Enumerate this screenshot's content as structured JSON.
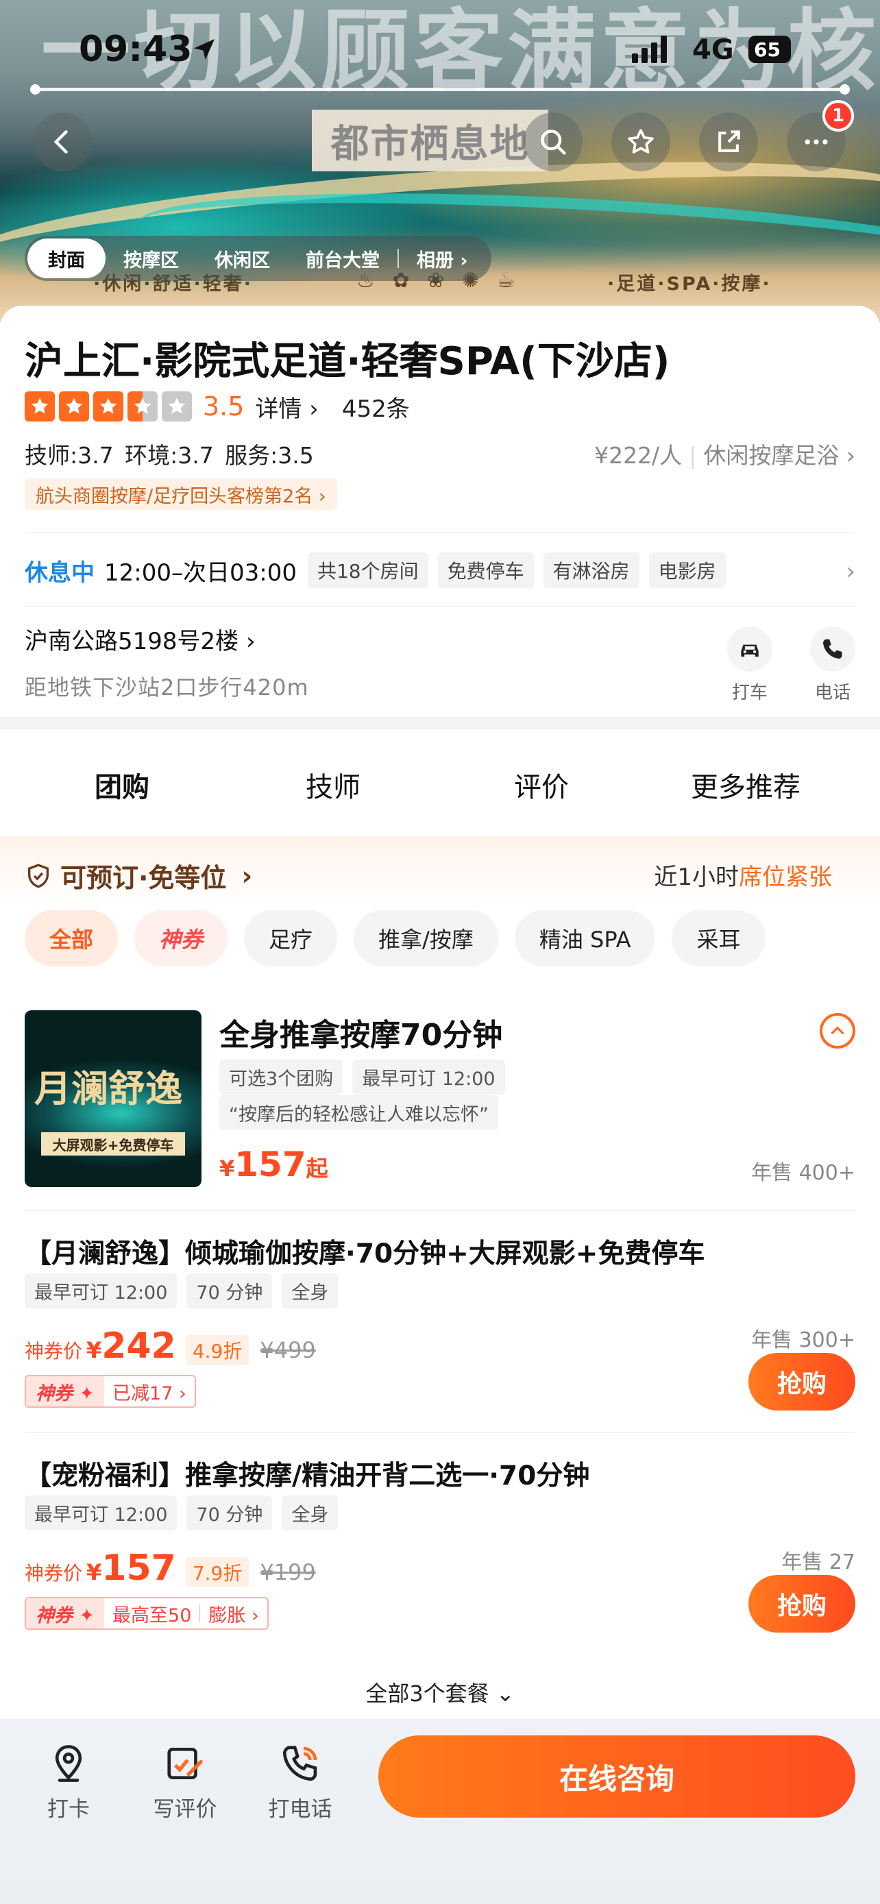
{
  "status_bar": {
    "time": "09:43",
    "network": "4G",
    "battery": "65"
  },
  "hero": {
    "slogan": "一切以顾客满意为核心",
    "sign": "都市栖息地",
    "sub_left": "·休闲·舒适·轻奢·",
    "sub_right": "·足道·SPA·按摩·",
    "badge": "1",
    "tabs": [
      "封面",
      "按摩区",
      "休闲区",
      "前台大堂",
      "相册 ›"
    ]
  },
  "shop": {
    "title": "沪上汇·影院式足道·轻奢SPA(下沙店)",
    "rating": 3.5,
    "score": "3.5",
    "details_link": "详情 ›",
    "review_count": "452条",
    "sub_scores": "技师:3.7  环境:3.7  服务:3.5",
    "price": "¥222/人",
    "category": "休闲按摩足浴 ›",
    "rank": "航头商圈按摩/足疗回头客榜第2名 ›",
    "status": "休息中",
    "hours": "12:00–次日03:00",
    "features": [
      "共18个房间",
      "免费停车",
      "有淋浴房",
      "电影房"
    ],
    "address": "沪南公路5198号2楼 ›",
    "metro": "距地铁下沙站2口步行420m",
    "actions": {
      "taxi": "打车",
      "phone": "电话"
    }
  },
  "main_tabs": [
    "团购",
    "技师",
    "评价",
    "更多推荐"
  ],
  "booking": {
    "left": "可预订·免等位",
    "right_prefix": "近1小时",
    "right_hl": "席位紧张"
  },
  "filters": [
    "全部",
    "神券",
    "足疗",
    "推拿/按摩",
    "精油 SPA",
    "采耳"
  ],
  "package": {
    "thumb_text": "月澜舒逸",
    "thumb_sub": "大屏观影+免费停车",
    "title": "全身推拿按摩70分钟",
    "tags": [
      "可选3个团购",
      "最早可订 12:00"
    ],
    "quote": "“按摩后的轻松感让人难以忘怀”",
    "price_yen": "¥",
    "price": "157",
    "price_suffix": "起",
    "sold": "年售 400+"
  },
  "deals": [
    {
      "title": "【月澜舒逸】倾城瑜伽按摩·70分钟+大屏观影+免费停车",
      "tags": [
        "最早可订 12:00",
        "70 分钟",
        "全身"
      ],
      "price_label": "神券价",
      "yen": "¥",
      "price": "242",
      "discount": "4.9折",
      "original": "¥499",
      "coupon_tag": "神券 ✦",
      "coupon_text": "已减17 ›",
      "coupon_extra": "",
      "sold": "年售 300+",
      "button": "抢购"
    },
    {
      "title": "【宠粉福利】推拿按摩/精油开背二选一·70分钟",
      "tags": [
        "最早可订 12:00",
        "70 分钟",
        "全身"
      ],
      "price_label": "神券价",
      "yen": "¥",
      "price": "157",
      "discount": "7.9折",
      "original": "¥199",
      "coupon_tag": "神券 ✦",
      "coupon_text": "最高至50",
      "coupon_extra": "膨胀 ›",
      "sold": "年售 27",
      "button": "抢购"
    }
  ],
  "all_packages": "全部3个套餐 ⌄",
  "bottom_bar": {
    "checkin": "打卡",
    "review": "写评价",
    "call": "打电话",
    "consult": "在线咨询"
  },
  "colors": {
    "accent": "#ff6a1f",
    "status_blue": "#1e88e5",
    "coupon_red": "#ff3d3d"
  }
}
